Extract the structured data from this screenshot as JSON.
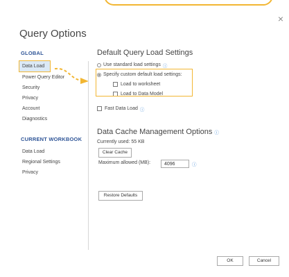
{
  "dialog": {
    "title": "Query Options",
    "close_glyph": "×"
  },
  "sidebar": {
    "global_title": "GLOBAL",
    "global_items": [
      {
        "label": "Data Load",
        "active": true
      },
      {
        "label": "Power Query Editor"
      },
      {
        "label": "Security"
      },
      {
        "label": "Privacy"
      },
      {
        "label": "Account"
      },
      {
        "label": "Diagnostics"
      }
    ],
    "workbook_title": "CURRENT WORKBOOK",
    "workbook_items": [
      {
        "label": "Data Load"
      },
      {
        "label": "Regional Settings"
      },
      {
        "label": "Privacy"
      }
    ]
  },
  "main": {
    "default_title": "Default Query Load Settings",
    "use_standard": "Use standard load settings",
    "specify_custom": "Specify custom default load settings:",
    "load_worksheet": "Load to worksheet",
    "load_model": "Load to Data Model",
    "fast_load": "Fast Data Load",
    "cache_title": "Data Cache Management Options",
    "currently_used": "Currently used: 55 KB",
    "clear_cache": "Clear Cache",
    "max_allowed": "Maximum allowed (MB):",
    "max_value": "4096",
    "restore_defaults": "Restore Defaults"
  },
  "footer": {
    "ok": "OK",
    "cancel": "Cancel"
  },
  "colors": {
    "accent": "#f2b632",
    "section": "#2f5597",
    "active_bg": "#dbe9f6",
    "info": "#4a8fd9"
  },
  "icons": {
    "info": "info-icon",
    "arrow": "curved-arrow-icon"
  }
}
